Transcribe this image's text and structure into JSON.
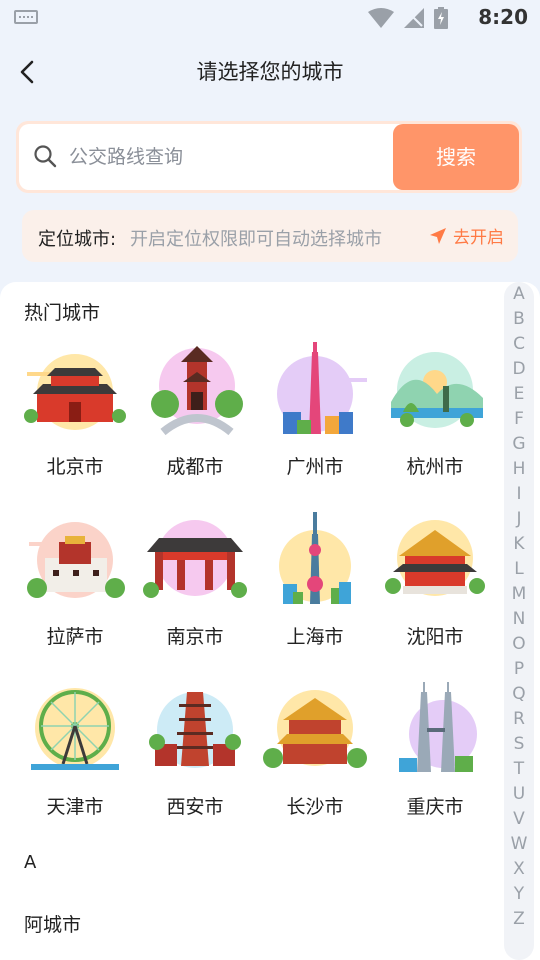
{
  "status": {
    "time": "8:20"
  },
  "header": {
    "title": "请选择您的城市"
  },
  "search": {
    "placeholder": "公交路线查询",
    "button": "搜索"
  },
  "location": {
    "label": "定位城市:",
    "hint": "开启定位权限即可自动选择城市",
    "action": "去开启"
  },
  "hot": {
    "title": "热门城市",
    "cities": [
      "北京市",
      "成都市",
      "广州市",
      "杭州市",
      "拉萨市",
      "南京市",
      "上海市",
      "沈阳市",
      "天津市",
      "西安市",
      "长沙市",
      "重庆市"
    ]
  },
  "list": {
    "letter": "A",
    "first_city": "阿城市"
  },
  "index_letters": [
    "A",
    "B",
    "C",
    "D",
    "E",
    "F",
    "G",
    "H",
    "I",
    "J",
    "K",
    "L",
    "M",
    "N",
    "O",
    "P",
    "Q",
    "R",
    "S",
    "T",
    "U",
    "V",
    "W",
    "X",
    "Y",
    "Z"
  ],
  "colors": {
    "accent": "#ff9569",
    "link": "#ff7a45"
  }
}
